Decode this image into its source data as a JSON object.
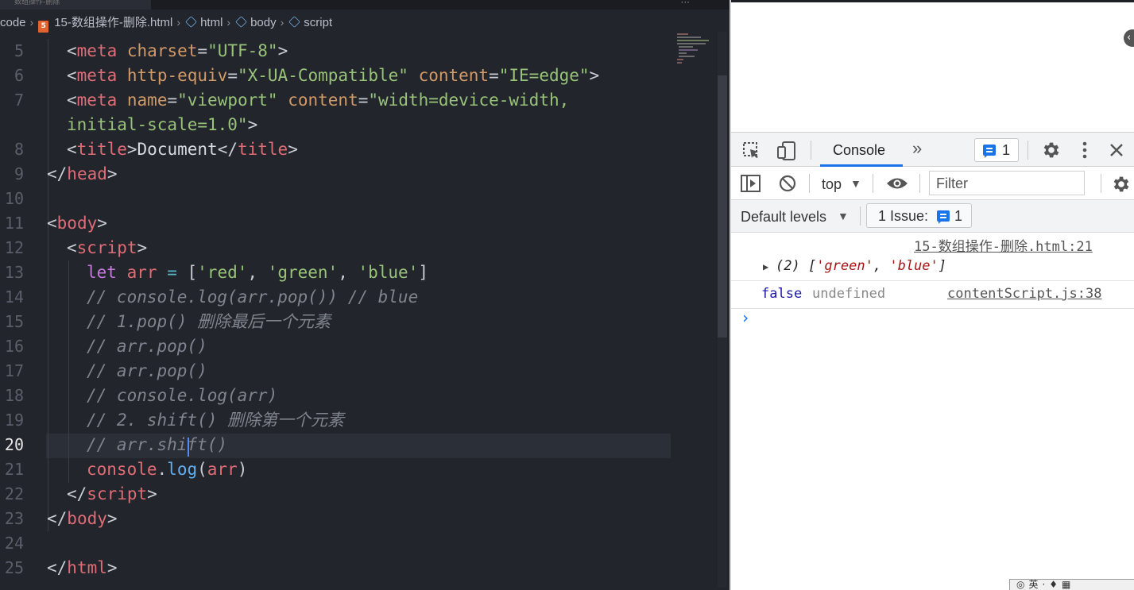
{
  "editor": {
    "tab_fragment": "数组操作-删除",
    "breadcrumb": [
      "code",
      "15-数组操作-删除.html",
      "html",
      "body",
      "script"
    ],
    "breadcrumb_html_badge": "5",
    "active_line": 20,
    "lines": [
      {
        "n": "5",
        "tokens": [
          [
            "br",
            "<"
          ],
          [
            "tag",
            "meta"
          ],
          [
            "txt",
            " "
          ],
          [
            "attr",
            "charset"
          ],
          [
            "br",
            "="
          ],
          [
            "str",
            "\"UTF-8\""
          ],
          [
            "br",
            ">"
          ]
        ],
        "indent": 84
      },
      {
        "n": "6",
        "tokens": [
          [
            "br",
            "<"
          ],
          [
            "tag",
            "meta"
          ],
          [
            "txt",
            " "
          ],
          [
            "attr",
            "http-equiv"
          ],
          [
            "br",
            "="
          ],
          [
            "str",
            "\"X-UA-Compatible\""
          ],
          [
            "txt",
            " "
          ],
          [
            "attr",
            "content"
          ],
          [
            "br",
            "="
          ],
          [
            "str",
            "\"IE=edge\""
          ],
          [
            "br",
            ">"
          ]
        ],
        "indent": 84
      },
      {
        "n": "7",
        "tokens": [
          [
            "br",
            "<"
          ],
          [
            "tag",
            "meta"
          ],
          [
            "txt",
            " "
          ],
          [
            "attr",
            "name"
          ],
          [
            "br",
            "="
          ],
          [
            "str",
            "\"viewport\""
          ],
          [
            "txt",
            " "
          ],
          [
            "attr",
            "content"
          ],
          [
            "br",
            "="
          ],
          [
            "str",
            "\"width=device-width,"
          ]
        ],
        "indent": 84
      },
      {
        "n": "",
        "tokens": [
          [
            "str",
            "initial-scale=1.0\""
          ],
          [
            "br",
            ">"
          ]
        ],
        "indent": 84
      },
      {
        "n": "8",
        "tokens": [
          [
            "br",
            "<"
          ],
          [
            "tag",
            "title"
          ],
          [
            "br",
            ">"
          ],
          [
            "txt",
            "Document"
          ],
          [
            "br",
            "</"
          ],
          [
            "tag",
            "title"
          ],
          [
            "br",
            ">"
          ]
        ],
        "indent": 84
      },
      {
        "n": "9",
        "tokens": [
          [
            "br",
            "</"
          ],
          [
            "tag",
            "head"
          ],
          [
            "br",
            ">"
          ]
        ],
        "indent": 59
      },
      {
        "n": "10",
        "tokens": [],
        "indent": 59
      },
      {
        "n": "11",
        "tokens": [
          [
            "br",
            "<"
          ],
          [
            "tag",
            "body"
          ],
          [
            "br",
            ">"
          ]
        ],
        "indent": 59
      },
      {
        "n": "12",
        "tokens": [
          [
            "br",
            "<"
          ],
          [
            "tag",
            "script"
          ],
          [
            "br",
            ">"
          ]
        ],
        "indent": 84
      },
      {
        "n": "13",
        "tokens": [
          [
            "kw",
            "let"
          ],
          [
            "txt",
            " "
          ],
          [
            "var",
            "arr"
          ],
          [
            "txt",
            " "
          ],
          [
            "op",
            "="
          ],
          [
            "txt",
            " "
          ],
          [
            "br",
            "["
          ],
          [
            "str",
            "'red'"
          ],
          [
            "br",
            ", "
          ],
          [
            "str",
            "'green'"
          ],
          [
            "br",
            ", "
          ],
          [
            "str",
            "'blue'"
          ],
          [
            "br",
            "]"
          ]
        ],
        "indent": 109
      },
      {
        "n": "14",
        "tokens": [
          [
            "com",
            "// console.log(arr.pop()) // blue"
          ]
        ],
        "indent": 109
      },
      {
        "n": "15",
        "tokens": [
          [
            "com",
            "// 1.pop() 删除最后一个元素"
          ]
        ],
        "indent": 109
      },
      {
        "n": "16",
        "tokens": [
          [
            "com",
            "// arr.pop()"
          ]
        ],
        "indent": 109
      },
      {
        "n": "17",
        "tokens": [
          [
            "com",
            "// arr.pop()"
          ]
        ],
        "indent": 109
      },
      {
        "n": "18",
        "tokens": [
          [
            "com",
            "// console.log(arr)"
          ]
        ],
        "indent": 109
      },
      {
        "n": "19",
        "tokens": [
          [
            "com",
            "// 2. shift() 删除第一个元素"
          ]
        ],
        "indent": 109
      },
      {
        "n": "20",
        "tokens": [
          [
            "com",
            "// arr.shift()"
          ]
        ],
        "indent": 109
      },
      {
        "n": "21",
        "tokens": [
          [
            "var",
            "console"
          ],
          [
            "br",
            "."
          ],
          [
            "fn",
            "log"
          ],
          [
            "br",
            "("
          ],
          [
            "var",
            "arr"
          ],
          [
            "br",
            ")"
          ]
        ],
        "indent": 109
      },
      {
        "n": "22",
        "tokens": [
          [
            "br",
            "</"
          ],
          [
            "tag",
            "script"
          ],
          [
            "br",
            ">"
          ]
        ],
        "indent": 84
      },
      {
        "n": "23",
        "tokens": [
          [
            "br",
            "</"
          ],
          [
            "tag",
            "body"
          ],
          [
            "br",
            ">"
          ]
        ],
        "indent": 59
      },
      {
        "n": "24",
        "tokens": [],
        "indent": 59
      },
      {
        "n": "25",
        "tokens": [
          [
            "br",
            "</"
          ],
          [
            "tag",
            "html"
          ],
          [
            "br",
            ">"
          ]
        ],
        "indent": 59
      }
    ]
  },
  "devtools": {
    "tab_console": "Console",
    "more_tabs": "»",
    "issues_badge_count": "1",
    "context": "top",
    "filter_placeholder": "Filter",
    "levels": "Default levels",
    "issues_label": "1 Issue:",
    "issues_count": "1",
    "logs": [
      {
        "source": "15-数组操作-删除.html:21",
        "value_prefix": "(2) [",
        "items": [
          "'green'",
          "'blue'"
        ],
        "value_suffix": "]"
      },
      {
        "source": "contentScript.js:38",
        "value_false": "false",
        "value_undefined": "undefined"
      }
    ],
    "prompt": "›"
  },
  "colors": {
    "editor_bg": "#22252c",
    "accent_blue": "#1a73e8",
    "string": "#98c379",
    "tag": "#e06c75",
    "attr": "#d19a66",
    "keyword": "#c678dd"
  }
}
